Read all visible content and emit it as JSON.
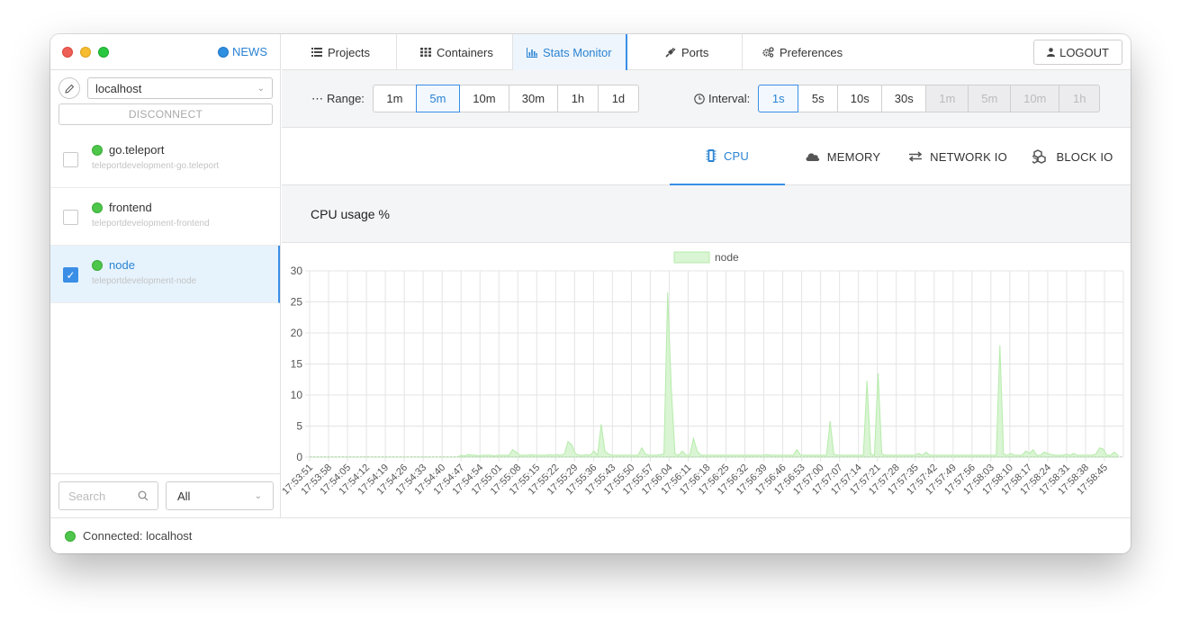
{
  "sidebar": {
    "news_label": "NEWS",
    "host_value": "localhost",
    "disconnect_label": "DISCONNECT",
    "containers": [
      {
        "name": "go.teleport",
        "full_name": "teleportdevelopment-go.teleport",
        "checked": false
      },
      {
        "name": "frontend",
        "full_name": "teleportdevelopment-frontend",
        "checked": false
      },
      {
        "name": "node",
        "full_name": "teleportdevelopment-node",
        "checked": true
      }
    ],
    "search_placeholder": "Search",
    "filter_value": "All"
  },
  "nav": {
    "projects": "Projects",
    "containers": "Containers",
    "stats_monitor": "Stats Monitor",
    "ports": "Ports",
    "preferences": "Preferences",
    "logout": "LOGOUT"
  },
  "range": {
    "label": "Range:",
    "options": [
      "1m",
      "5m",
      "10m",
      "30m",
      "1h",
      "1d"
    ],
    "selected": "5m"
  },
  "interval": {
    "label": "Interval:",
    "options": [
      "1s",
      "5s",
      "10s",
      "30s",
      "1m",
      "5m",
      "10m",
      "1h"
    ],
    "selected": "1s",
    "disabled": [
      "1m",
      "5m",
      "10m",
      "1h"
    ]
  },
  "metric_tabs": {
    "cpu": "CPU",
    "memory": "MEMORY",
    "network_io": "NETWORK IO",
    "block_io": "BLOCK IO"
  },
  "chart_title": "CPU usage %",
  "status": {
    "text": "Connected: localhost",
    "color": "#4ec54b"
  },
  "colors": {
    "accent": "#2b83d3",
    "series_fill": "#d9f5d3",
    "series_stroke": "#b6ebab"
  },
  "chart_data": {
    "type": "area",
    "legend": "top-center",
    "grid": true,
    "series": [
      {
        "name": "node"
      }
    ],
    "ylim": [
      0,
      30
    ],
    "yticks": [
      0,
      5,
      10,
      15,
      20,
      25,
      30
    ],
    "xtick_labels": [
      "17:53:51",
      "17:53:58",
      "17:54:05",
      "17:54:12",
      "17:54:19",
      "17:54:26",
      "17:54:33",
      "17:54:40",
      "17:54:47",
      "17:54:54",
      "17:55:01",
      "17:55:08",
      "17:55:15",
      "17:55:22",
      "17:55:29",
      "17:55:36",
      "17:55:43",
      "17:55:50",
      "17:55:57",
      "17:56:04",
      "17:56:11",
      "17:56:18",
      "17:56:25",
      "17:56:32",
      "17:56:39",
      "17:56:46",
      "17:56:53",
      "17:57:00",
      "17:57:07",
      "17:57:14",
      "17:57:21",
      "17:57:28",
      "17:57:35",
      "17:57:42",
      "17:57:49",
      "17:57:56",
      "17:58:03",
      "17:58:10",
      "17:58:17",
      "17:58:24",
      "17:58:31",
      "17:58:38",
      "17:58:45"
    ],
    "points": [
      [
        0,
        0
      ],
      [
        40,
        0
      ],
      [
        41,
        0.3
      ],
      [
        42,
        0.2
      ],
      [
        43,
        0.4
      ],
      [
        44,
        0.3
      ],
      [
        45,
        0.3
      ],
      [
        46,
        0.2
      ],
      [
        47,
        0.3
      ],
      [
        48,
        0.3
      ],
      [
        49,
        0.3
      ],
      [
        50,
        0.2
      ],
      [
        51,
        0.3
      ],
      [
        52,
        0.3
      ],
      [
        53,
        0.3
      ],
      [
        54,
        0.3
      ],
      [
        55,
        1.2
      ],
      [
        56,
        0.8
      ],
      [
        57,
        0.3
      ],
      [
        58,
        0.3
      ],
      [
        59,
        0.3
      ],
      [
        60,
        0.4
      ],
      [
        61,
        0.3
      ],
      [
        62,
        0.3
      ],
      [
        63,
        0.3
      ],
      [
        64,
        0.3
      ],
      [
        65,
        0.4
      ],
      [
        66,
        0.3
      ],
      [
        67,
        0.4
      ],
      [
        68,
        0.3
      ],
      [
        69,
        0.5
      ],
      [
        70,
        2.5
      ],
      [
        71,
        2.0
      ],
      [
        72,
        0.6
      ],
      [
        73,
        0.3
      ],
      [
        74,
        0.3
      ],
      [
        75,
        0.4
      ],
      [
        76,
        0.3
      ],
      [
        77,
        1.0
      ],
      [
        78,
        0.3
      ],
      [
        79,
        5.3
      ],
      [
        80,
        1.0
      ],
      [
        81,
        0.5
      ],
      [
        82,
        0.3
      ],
      [
        83,
        0.3
      ],
      [
        84,
        0.3
      ],
      [
        85,
        0.3
      ],
      [
        86,
        0.3
      ],
      [
        87,
        0.3
      ],
      [
        88,
        0.3
      ],
      [
        89,
        0.3
      ],
      [
        90,
        1.5
      ],
      [
        91,
        0.5
      ],
      [
        92,
        0.3
      ],
      [
        93,
        0.3
      ],
      [
        94,
        0.3
      ],
      [
        95,
        0.4
      ],
      [
        96,
        0.5
      ],
      [
        97,
        26.5
      ],
      [
        98,
        11
      ],
      [
        99,
        0.5
      ],
      [
        100,
        0.3
      ],
      [
        101,
        1.0
      ],
      [
        102,
        0.3
      ],
      [
        103,
        0.3
      ],
      [
        104,
        3.0
      ],
      [
        105,
        1.0
      ],
      [
        106,
        0.3
      ],
      [
        107,
        0.3
      ],
      [
        108,
        0.3
      ],
      [
        109,
        0.3
      ],
      [
        110,
        0.3
      ],
      [
        111,
        0.3
      ],
      [
        112,
        0.3
      ],
      [
        113,
        0.3
      ],
      [
        114,
        0.3
      ],
      [
        115,
        0.3
      ],
      [
        116,
        0.3
      ],
      [
        117,
        0.3
      ],
      [
        118,
        0.3
      ],
      [
        119,
        0.3
      ],
      [
        120,
        0.3
      ],
      [
        121,
        0.3
      ],
      [
        122,
        0.3
      ],
      [
        123,
        0.3
      ],
      [
        124,
        0.4
      ],
      [
        125,
        0.3
      ],
      [
        126,
        0.3
      ],
      [
        127,
        0.3
      ],
      [
        128,
        0.3
      ],
      [
        129,
        0.3
      ],
      [
        130,
        0.3
      ],
      [
        131,
        0.3
      ],
      [
        132,
        1.2
      ],
      [
        133,
        0.3
      ],
      [
        134,
        0.3
      ],
      [
        135,
        0.3
      ],
      [
        136,
        0.3
      ],
      [
        137,
        0.3
      ],
      [
        138,
        0.3
      ],
      [
        139,
        0.3
      ],
      [
        140,
        0.3
      ],
      [
        141,
        5.8
      ],
      [
        142,
        0.5
      ],
      [
        143,
        0.3
      ],
      [
        144,
        0.3
      ],
      [
        145,
        0.3
      ],
      [
        146,
        0.3
      ],
      [
        147,
        0.3
      ],
      [
        148,
        0.3
      ],
      [
        149,
        0.3
      ],
      [
        150,
        0.3
      ],
      [
        151,
        12.3
      ],
      [
        152,
        0.5
      ],
      [
        153,
        0.3
      ],
      [
        154,
        13.5
      ],
      [
        155,
        0.5
      ],
      [
        156,
        0.3
      ],
      [
        157,
        0.3
      ],
      [
        158,
        0.3
      ],
      [
        159,
        0.3
      ],
      [
        160,
        0.3
      ],
      [
        161,
        0.3
      ],
      [
        162,
        0.3
      ],
      [
        163,
        0.3
      ],
      [
        164,
        0.3
      ],
      [
        165,
        0.6
      ],
      [
        166,
        0.3
      ],
      [
        167,
        0.8
      ],
      [
        168,
        0.3
      ],
      [
        169,
        0.3
      ],
      [
        170,
        0.3
      ],
      [
        171,
        0.3
      ],
      [
        172,
        0.3
      ],
      [
        173,
        0.3
      ],
      [
        174,
        0.3
      ],
      [
        175,
        0.3
      ],
      [
        176,
        0.3
      ],
      [
        177,
        0.3
      ],
      [
        178,
        0.3
      ],
      [
        179,
        0.3
      ],
      [
        180,
        0.3
      ],
      [
        181,
        0.3
      ],
      [
        182,
        0.3
      ],
      [
        183,
        0.3
      ],
      [
        184,
        0.3
      ],
      [
        185,
        0.3
      ],
      [
        186,
        0.3
      ],
      [
        187,
        18.0
      ],
      [
        188,
        0.5
      ],
      [
        189,
        0.3
      ],
      [
        190,
        0.6
      ],
      [
        191,
        0.3
      ],
      [
        192,
        0.3
      ],
      [
        193,
        0.3
      ],
      [
        194,
        1.0
      ],
      [
        195,
        0.6
      ],
      [
        196,
        1.2
      ],
      [
        197,
        0.3
      ],
      [
        198,
        0.3
      ],
      [
        199,
        0.8
      ],
      [
        200,
        0.6
      ],
      [
        201,
        0.4
      ],
      [
        202,
        0.3
      ],
      [
        203,
        0.3
      ],
      [
        204,
        0.3
      ],
      [
        205,
        0.5
      ],
      [
        206,
        0.3
      ],
      [
        207,
        0.6
      ],
      [
        208,
        0.3
      ],
      [
        209,
        0.3
      ],
      [
        210,
        0.3
      ],
      [
        211,
        0.3
      ],
      [
        212,
        0.3
      ],
      [
        213,
        0.5
      ],
      [
        214,
        1.5
      ],
      [
        215,
        1.3
      ],
      [
        216,
        0.3
      ],
      [
        217,
        0.3
      ],
      [
        218,
        0.8
      ],
      [
        219,
        0.3
      ]
    ],
    "x_max": 219
  }
}
